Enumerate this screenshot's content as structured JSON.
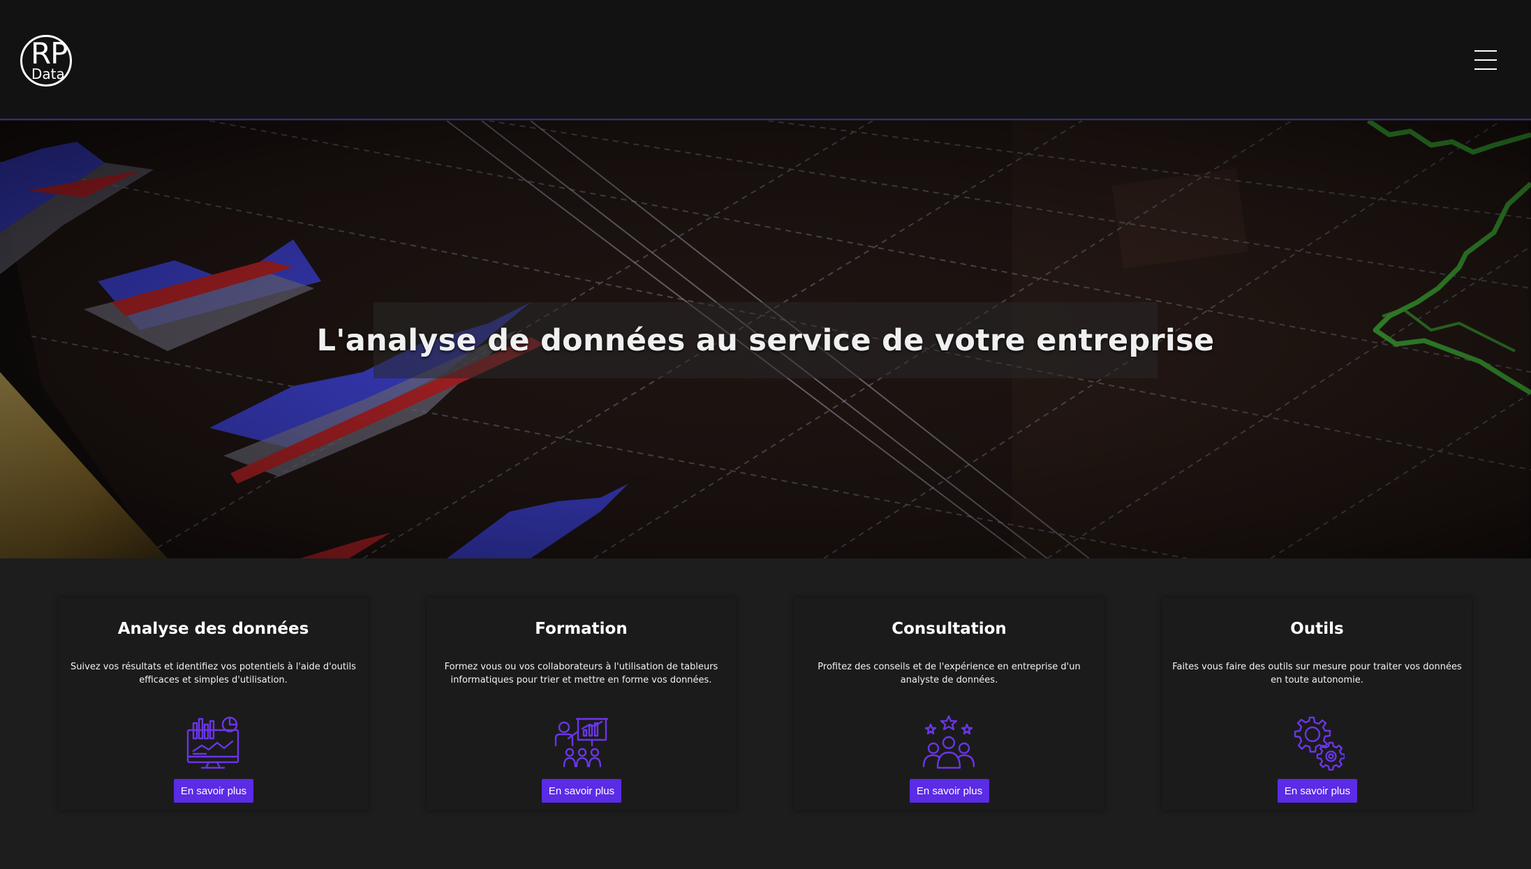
{
  "header": {
    "logo": {
      "text_top": "RP",
      "text_bottom": "Data"
    },
    "menu_icon": "hamburger-menu-icon"
  },
  "hero": {
    "title": "L'analyse de données au service de votre entreprise",
    "background_colors": {
      "blue": "#3f48ff",
      "red": "#d8232a",
      "green": "#3fd63a",
      "grid": "#9aa3b5"
    }
  },
  "services": [
    {
      "title": "Analyse des données",
      "description": "Suivez vos résultats et identifiez vos potentiels à l'aide d'outils efficaces et simples d'utilisation.",
      "icon": "data-dashboard-icon",
      "button_label": "En savoir plus"
    },
    {
      "title": "Formation",
      "description": "Formez vous ou vos collaborateurs à l'utilisation de tableurs informatiques pour trier et mettre en forme vos données.",
      "icon": "training-presentation-icon",
      "button_label": "En savoir plus"
    },
    {
      "title": "Consultation",
      "description": "Profitez des conseils et de l'expérience en entreprise d'un analyste de données.",
      "icon": "team-stars-icon",
      "button_label": "En savoir plus"
    },
    {
      "title": "Outils",
      "description": "Faites vous faire des outils sur mesure pour traiter vos données en toute autonomie.",
      "icon": "gears-icon",
      "button_label": "En savoir plus"
    }
  ],
  "theme": {
    "accent": "#5b2be6",
    "icon_color": "#6b35e8",
    "header_bg": "#121212",
    "section_bg": "#1d1d1d"
  }
}
